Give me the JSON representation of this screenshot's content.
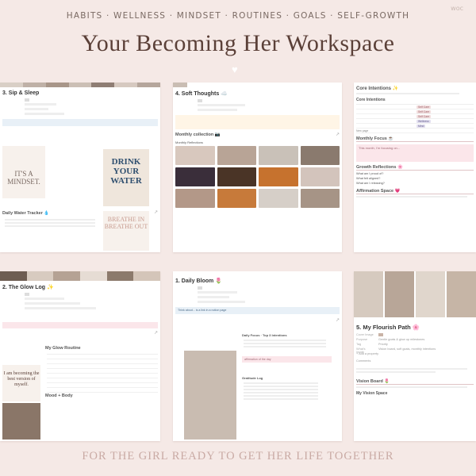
{
  "header": {
    "watermark": "woc",
    "tagline": "HABITS · WELLNESS · MINDSET · ROUTINES · GOALS · SELF-GROWTH",
    "title": "Your Becoming Her Workspace",
    "heart": "♥"
  },
  "footer": {
    "text": "FOR THE GIRL READY TO GET HER LIFE TOGETHER"
  },
  "cards": {
    "sip_sleep": {
      "title": "3. Sip & Sleep",
      "daily_water_tracker": "Daily Water Tracker 💧",
      "posters": [
        "DRINK YOUR WATER",
        "BREATHE IN BREATHE OUT",
        "IT'S A MINDSET."
      ]
    },
    "soft_thoughts": {
      "title": "4. Soft Thoughts ☁️",
      "monthly_collection": "Monthly collection 📷",
      "monthly_reflections": "Monthly Reflections"
    },
    "core_intentions": {
      "title": "Core Intentions ✨",
      "subtitle": "Core Intentions",
      "monthly_focus": "Monthly Focus ☕",
      "focus_text": "This month, I'm focusing on...",
      "growth_reflections": "Growth Reflections 🌸",
      "reflections": [
        "What am I proud of?",
        "What felt aligned?",
        "What am I releasing?"
      ],
      "affirmation_space": "Affirmation Space 💗",
      "new_page": "New page",
      "tags": [
        "Self Care",
        "Self Care",
        "Self Care",
        "Wellness",
        "Mind"
      ]
    },
    "glow_log": {
      "title": "2. The Glow Log ✨",
      "routine_title": "My Glow Routine",
      "mood_title": "Mood + Body",
      "poster_text": "I am becoming the best version of myself."
    },
    "daily_bloom": {
      "title": "1. Daily Bloom 🌷",
      "note": "Think about... is a link in a notion page",
      "tasks_title": "Daily Focus · Top 3 Intentions",
      "gratitude_title": "Gratitude Log",
      "affirmation": "affirmation of the day"
    },
    "flourish_path": {
      "title": "5. My Flourish Path 🌸",
      "fields": [
        {
          "label": "Cover Image",
          "value": ""
        },
        {
          "label": "Purpose",
          "value": "Gentle goals & glow up milestones"
        },
        {
          "label": "Tag",
          "value": "Priority"
        },
        {
          "label": "What's inside",
          "value": "Vision board, soft goals, monthly intentions"
        }
      ],
      "add_property": "+ Add a property",
      "comments": "Comments",
      "vision_board": "Vision Board 🌷",
      "vision_space": "My Vision Space"
    }
  },
  "colors": {
    "background": "#f5e9e6",
    "title": "#5b4038",
    "footer": "#c9aaa4"
  }
}
